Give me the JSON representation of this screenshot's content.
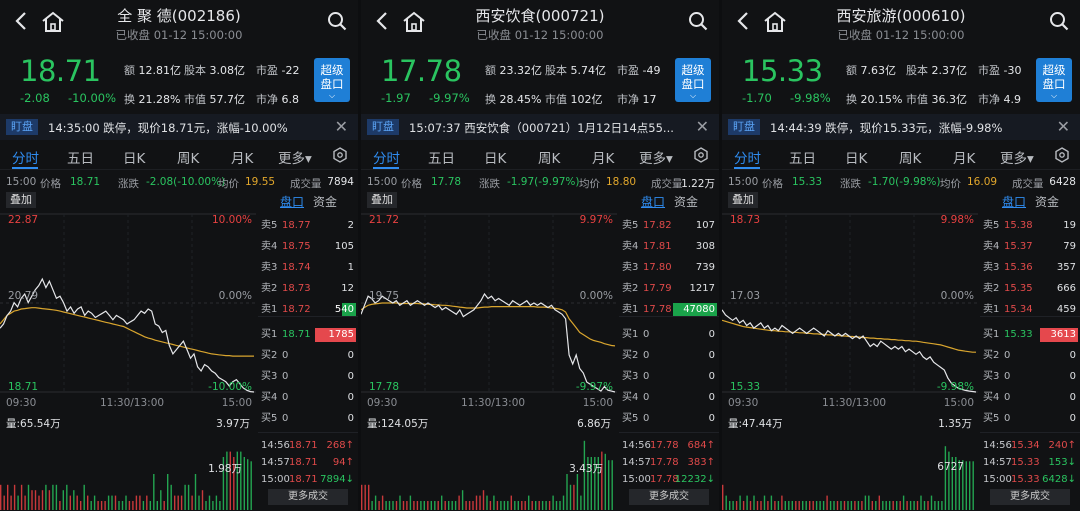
{
  "panels": [
    {
      "title": "全 聚 德(002186)",
      "status": "已收盘 01-12 15:00:00",
      "price": "18.71",
      "change": "-2.08",
      "change_pct": "-10.00%",
      "metrics": {
        "amount_label": "额",
        "amount": "12.81亿",
        "shares_label": "股本",
        "shares": "3.08亿",
        "pe_label": "市盈",
        "pe": "-22",
        "turnover_label": "换",
        "turnover": "21.28%",
        "mcap_label": "市值",
        "mcap": "57.7亿",
        "pb_label": "市净",
        "pb": "6.8"
      },
      "super_btn": "超级",
      "super_btn2": "盘口",
      "alert_tag": "盯盘",
      "alert_text": "14:35:00 跌停，现价18.71元，涨幅-10.00%",
      "tabs": [
        "分时",
        "五日",
        "日K",
        "周K",
        "月K",
        "更多▾"
      ],
      "info": {
        "time": "15:00",
        "price_label": "价格",
        "price": "18.71",
        "chg_label": "涨跌",
        "chg": "-2.08(-10.00%)",
        "avg_label": "均价",
        "avg": "19.55",
        "vol_label": "成交量",
        "vol": "7894"
      },
      "overlay_btn": "叠加",
      "chart": {
        "high": "22.87",
        "high_pct": "10.00%",
        "mid": "20.79",
        "mid_pct": "0.00%",
        "low": "18.71",
        "low_pct": "-10.00%",
        "t1": "09:30",
        "t2": "11:30/13:00",
        "t3": "15:00",
        "prev_close": 20.79,
        "ymax": 22.87,
        "ymin": 18.71,
        "price_line": [
          20.2,
          20.3,
          20.5,
          20.6,
          20.8,
          20.7,
          20.9,
          21.0,
          20.8,
          20.95,
          21.1,
          21.2,
          21.35,
          21.15,
          21.3,
          21.1,
          20.9,
          20.95,
          20.8,
          20.6,
          20.7,
          20.55,
          20.65,
          20.7,
          20.5,
          20.6,
          20.55,
          20.45,
          20.5,
          20.55,
          20.6,
          20.5,
          20.4,
          20.5,
          20.45,
          20.4,
          20.3,
          20.35,
          20.4,
          20.5,
          20.6,
          20.55,
          20.65,
          20.6,
          20.3,
          20.25,
          20.1,
          20.15,
          19.8,
          19.6,
          19.7,
          19.8,
          19.9,
          19.7,
          19.5,
          19.6,
          19.3,
          19.2,
          19.35,
          19.3,
          19.2,
          19.15,
          19.05,
          19.0,
          18.95,
          18.85,
          18.95,
          19.0,
          18.9,
          18.8,
          18.75,
          18.72,
          18.71
        ],
        "avg_line": [
          20.3,
          20.4,
          20.5,
          20.55,
          20.6,
          20.62,
          20.65,
          20.66,
          20.67,
          20.68,
          20.68,
          20.67,
          20.66,
          20.65,
          20.64,
          20.63,
          20.62,
          20.6,
          20.58,
          20.56,
          20.54,
          20.52,
          20.5,
          20.48,
          20.46,
          20.44,
          20.42,
          20.4,
          20.38,
          20.36,
          20.34,
          20.32,
          20.3,
          20.28,
          20.26,
          20.24,
          20.2,
          20.16,
          20.12,
          20.08,
          20.04,
          20.0,
          19.97,
          19.95,
          19.92,
          19.9,
          19.88,
          19.86,
          19.84,
          19.82,
          19.8,
          19.78,
          19.76,
          19.74,
          19.72,
          19.7,
          19.68,
          19.66,
          19.64,
          19.62,
          19.6,
          19.59,
          19.58,
          19.57,
          19.56,
          19.56,
          19.55,
          19.55,
          19.55,
          19.55,
          19.55,
          19.55,
          19.55
        ]
      },
      "volume": {
        "label": "量:65.54万",
        "max": "3.97万",
        "mid": "1.98万"
      },
      "book": {
        "tab1": "盘口",
        "tab2": "资金",
        "rows": [
          {
            "l": "卖5",
            "p": "18.77",
            "q": "2"
          },
          {
            "l": "卖4",
            "p": "18.75",
            "q": "105"
          },
          {
            "l": "卖3",
            "p": "18.74",
            "q": "1"
          },
          {
            "l": "卖2",
            "p": "18.73",
            "q": "12"
          },
          {
            "l": "卖1",
            "p": "18.72",
            "q": "540"
          },
          {
            "l": "买1",
            "p": "18.71",
            "q": "1785"
          },
          {
            "l": "买2",
            "p": "0",
            "q": "0"
          },
          {
            "l": "买3",
            "p": "0",
            "q": "0"
          },
          {
            "l": "买4",
            "p": "0",
            "q": "0"
          },
          {
            "l": "买5",
            "p": "0",
            "q": "0"
          }
        ],
        "bars": {
          "sell1": 0.3,
          "buy1": 0.9
        },
        "ticks": [
          {
            "t": "14:56",
            "p": "18.71",
            "q": "268↑"
          },
          {
            "t": "14:57",
            "p": "18.71",
            "q": "94↑"
          },
          {
            "t": "15:00",
            "p": "18.71",
            "q": "7894↓"
          }
        ],
        "more": "更多成交"
      }
    },
    {
      "title": "西安饮食(000721)",
      "status": "已收盘 01-12 15:00:00",
      "price": "17.78",
      "change": "-1.97",
      "change_pct": "-9.97%",
      "metrics": {
        "amount_label": "额",
        "amount": "23.32亿",
        "shares_label": "股本",
        "shares": "5.74亿",
        "pe_label": "市盈",
        "pe": "-49",
        "turnover_label": "换",
        "turnover": "28.45%",
        "mcap_label": "市值",
        "mcap": "102亿",
        "pb_label": "市净",
        "pb": "17"
      },
      "super_btn": "超级",
      "super_btn2": "盘口",
      "alert_tag": "盯盘",
      "alert_text": "15:07:37 西安饮食（000721）1月12日14点55...",
      "tabs": [
        "分时",
        "五日",
        "日K",
        "周K",
        "月K",
        "更多▾"
      ],
      "info": {
        "time": "15:00",
        "price_label": "价格",
        "price": "17.78",
        "chg_label": "涨跌",
        "chg": "-1.97(-9.97%)",
        "avg_label": "均价",
        "avg": "18.80",
        "vol_label": "成交量",
        "vol": "1.22万"
      },
      "overlay_btn": "叠加",
      "chart": {
        "high": "21.72",
        "high_pct": "9.97%",
        "mid": "19.75",
        "mid_pct": "0.00%",
        "low": "17.78",
        "low_pct": "-9.97%",
        "t1": "09:30",
        "t2": "11:30/13:00",
        "t3": "15:00",
        "prev_close": 19.75,
        "ymax": 21.72,
        "ymin": 17.78,
        "price_line": [
          19.5,
          19.7,
          19.9,
          19.85,
          19.75,
          19.8,
          19.9,
          19.85,
          19.8,
          19.75,
          19.8,
          19.7,
          19.75,
          19.8,
          19.7,
          19.75,
          19.8,
          19.75,
          19.7,
          19.75,
          19.7,
          19.65,
          19.7,
          19.6,
          19.65,
          19.6,
          19.55,
          19.5,
          19.6,
          19.45,
          19.5,
          19.55,
          19.6,
          19.7,
          19.8,
          19.95,
          19.85,
          19.9,
          19.8,
          19.85,
          19.8,
          19.75,
          19.7,
          19.8,
          19.75,
          19.7,
          19.75,
          19.8,
          19.7,
          19.75,
          19.7,
          19.75,
          19.7,
          19.65,
          19.7,
          19.6,
          19.55,
          19.5,
          19.4,
          18.6,
          18.4,
          18.6,
          18.3,
          18.2,
          18.0,
          17.95,
          17.9,
          17.85,
          17.8,
          17.9,
          17.82,
          17.8,
          17.78
        ],
        "avg_line": [
          19.6,
          19.65,
          19.7,
          19.72,
          19.73,
          19.74,
          19.75,
          19.75,
          19.75,
          19.75,
          19.75,
          19.74,
          19.74,
          19.74,
          19.74,
          19.74,
          19.74,
          19.73,
          19.73,
          19.72,
          19.72,
          19.71,
          19.71,
          19.7,
          19.7,
          19.69,
          19.68,
          19.67,
          19.66,
          19.65,
          19.64,
          19.64,
          19.64,
          19.64,
          19.65,
          19.66,
          19.66,
          19.67,
          19.67,
          19.67,
          19.67,
          19.67,
          19.67,
          19.67,
          19.67,
          19.67,
          19.67,
          19.67,
          19.67,
          19.67,
          19.66,
          19.66,
          19.66,
          19.65,
          19.64,
          19.63,
          19.62,
          19.6,
          19.55,
          19.4,
          19.3,
          19.2,
          19.1,
          19.05,
          19.0,
          18.95,
          18.92,
          18.9,
          18.88,
          18.85,
          18.83,
          18.81,
          18.8
        ]
      },
      "volume": {
        "label": "量:124.05万",
        "max": "6.86万",
        "mid": "3.43万"
      },
      "book": {
        "tab1": "盘口",
        "tab2": "资金",
        "rows": [
          {
            "l": "卖5",
            "p": "17.82",
            "q": "107"
          },
          {
            "l": "卖4",
            "p": "17.81",
            "q": "308"
          },
          {
            "l": "卖3",
            "p": "17.80",
            "q": "739"
          },
          {
            "l": "卖2",
            "p": "17.79",
            "q": "1217"
          },
          {
            "l": "卖1",
            "p": "17.78",
            "q": "47080"
          },
          {
            "l": "买1",
            "p": "0",
            "q": "0"
          },
          {
            "l": "买2",
            "p": "0",
            "q": "0"
          },
          {
            "l": "买3",
            "p": "0",
            "q": "0"
          },
          {
            "l": "买4",
            "p": "0",
            "q": "0"
          },
          {
            "l": "买5",
            "p": "0",
            "q": "0"
          }
        ],
        "bars": {
          "sell1": 0.98,
          "buy1": 0
        },
        "ticks": [
          {
            "t": "14:56",
            "p": "17.78",
            "q": "684↑"
          },
          {
            "t": "14:57",
            "p": "17.78",
            "q": "383↑"
          },
          {
            "t": "15:00",
            "p": "17.78",
            "q": "12232↓"
          }
        ],
        "more": "更多成交"
      }
    },
    {
      "title": "西安旅游(000610)",
      "status": "已收盘 01-12 15:00:00",
      "price": "15.33",
      "change": "-1.70",
      "change_pct": "-9.98%",
      "metrics": {
        "amount_label": "额",
        "amount": "7.63亿",
        "shares_label": "股本",
        "shares": "2.37亿",
        "pe_label": "市盈",
        "pe": "-30",
        "turnover_label": "换",
        "turnover": "20.15%",
        "mcap_label": "市值",
        "mcap": "36.3亿",
        "pb_label": "市净",
        "pb": "4.9"
      },
      "super_btn": "超级",
      "super_btn2": "盘口",
      "alert_tag": "盯盘",
      "alert_text": "14:44:39 跌停，现价15.33元，涨幅-9.98%",
      "tabs": [
        "分时",
        "五日",
        "日K",
        "周K",
        "月K",
        "更多▾"
      ],
      "info": {
        "time": "15:00",
        "price_label": "价格",
        "price": "15.33",
        "chg_label": "涨跌",
        "chg": "-1.70(-9.98%)",
        "avg_label": "均价",
        "avg": "16.09",
        "vol_label": "成交量",
        "vol": "6428"
      },
      "overlay_btn": "叠加",
      "chart": {
        "high": "18.73",
        "high_pct": "9.98%",
        "mid": "17.03",
        "mid_pct": "0.00%",
        "low": "15.33",
        "low_pct": "-9.98%",
        "t1": "09:30",
        "t2": "11:30/13:00",
        "t3": "15:00",
        "prev_close": 17.03,
        "ymax": 18.73,
        "ymin": 15.33,
        "price_line": [
          16.9,
          16.8,
          16.75,
          16.7,
          16.75,
          16.65,
          16.7,
          16.6,
          16.65,
          16.55,
          16.6,
          16.65,
          16.55,
          16.6,
          16.5,
          16.55,
          16.5,
          16.6,
          16.55,
          16.5,
          16.45,
          16.5,
          16.55,
          16.5,
          16.45,
          16.5,
          16.55,
          16.5,
          16.45,
          16.4,
          16.5,
          16.45,
          16.4,
          16.45,
          16.4,
          16.45,
          16.4,
          16.35,
          16.4,
          16.35,
          16.4,
          16.3,
          16.2,
          16.25,
          16.2,
          16.3,
          16.25,
          16.2,
          16.15,
          16.2,
          16.15,
          16.2,
          16.1,
          16.15,
          16.1,
          16.05,
          16.1,
          16.0,
          15.95,
          16.0,
          15.9,
          15.85,
          15.8,
          15.75,
          15.6,
          15.5,
          15.45,
          15.4,
          15.38,
          15.36,
          15.35,
          15.34,
          15.33
        ],
        "avg_line": [
          16.7,
          16.68,
          16.66,
          16.64,
          16.62,
          16.6,
          16.58,
          16.57,
          16.56,
          16.55,
          16.54,
          16.53,
          16.52,
          16.51,
          16.5,
          16.5,
          16.49,
          16.49,
          16.48,
          16.48,
          16.47,
          16.47,
          16.46,
          16.46,
          16.45,
          16.45,
          16.44,
          16.44,
          16.43,
          16.43,
          16.42,
          16.42,
          16.41,
          16.41,
          16.4,
          16.4,
          16.39,
          16.39,
          16.38,
          16.38,
          16.37,
          16.37,
          16.36,
          16.36,
          16.35,
          16.35,
          16.34,
          16.34,
          16.33,
          16.33,
          16.32,
          16.32,
          16.31,
          16.31,
          16.3,
          16.3,
          16.29,
          16.28,
          16.27,
          16.26,
          16.25,
          16.24,
          16.23,
          16.21,
          16.19,
          16.17,
          16.15,
          16.13,
          16.12,
          16.11,
          16.1,
          16.09,
          16.09
        ]
      },
      "volume": {
        "label": "量:47.44万",
        "max": "1.35万",
        "mid": "6727"
      },
      "book": {
        "tab1": "盘口",
        "tab2": "资金",
        "rows": [
          {
            "l": "卖5",
            "p": "15.38",
            "q": "19"
          },
          {
            "l": "卖4",
            "p": "15.37",
            "q": "79"
          },
          {
            "l": "卖3",
            "p": "15.36",
            "q": "357"
          },
          {
            "l": "卖2",
            "p": "15.35",
            "q": "666"
          },
          {
            "l": "卖1",
            "p": "15.34",
            "q": "459"
          },
          {
            "l": "买1",
            "p": "15.33",
            "q": "3613"
          },
          {
            "l": "买2",
            "p": "0",
            "q": "0"
          },
          {
            "l": "买3",
            "p": "0",
            "q": "0"
          },
          {
            "l": "买4",
            "p": "0",
            "q": "0"
          },
          {
            "l": "买5",
            "p": "0",
            "q": "0"
          }
        ],
        "bars": {
          "sell1": 0,
          "buy1": 0.85
        },
        "ticks": [
          {
            "t": "14:56",
            "p": "15.34",
            "q": "240↑"
          },
          {
            "t": "14:57",
            "p": "15.33",
            "q": "153↓"
          },
          {
            "t": "15:00",
            "p": "15.33",
            "q": "6428↓"
          }
        ],
        "more": "更多成交"
      }
    }
  ],
  "colors": {
    "up": "#e84141",
    "down": "#2ac460",
    "accent": "#2f8cf0",
    "avg": "#d9a52e",
    "price_line": "#e6e7ea"
  }
}
